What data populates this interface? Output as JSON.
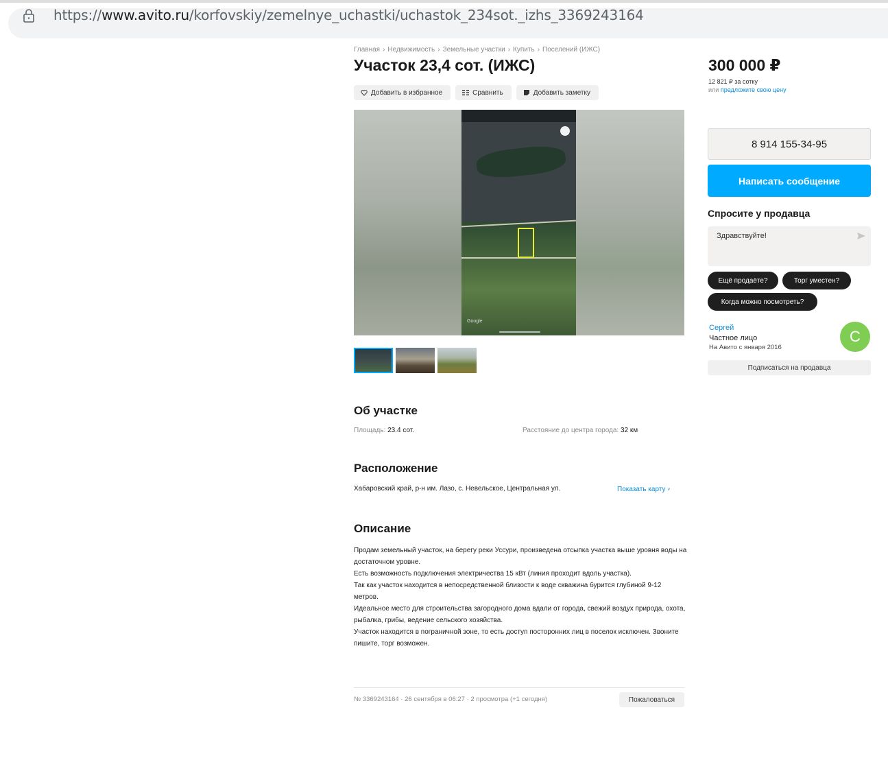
{
  "browser": {
    "url_prefix": "https://",
    "url_host": "www.avito.ru",
    "url_path": "/korfovskiy/zemelnye_uchastki/uchastok_234sot._izhs_3369243164"
  },
  "breadcrumbs": [
    "Главная",
    "Недвижимость",
    "Земельные участки",
    "Купить",
    "Поселений (ИЖС)"
  ],
  "breadcrumb_separator": "›",
  "listing": {
    "title": "Участок 23,4 сот. (ИЖС)",
    "actions": {
      "favorite": "Добавить в избранное",
      "compare": "Сравнить",
      "note": "Добавить заметку"
    },
    "photo_watermark": "Google"
  },
  "about": {
    "heading": "Об участке",
    "area_label": "Площадь:",
    "area_value": "23.4 сот.",
    "distance_label": "Расстояние до центра города:",
    "distance_value": "32 км"
  },
  "location": {
    "heading": "Расположение",
    "address": "Хабаровский край, р-н им. Лазо, с. Невельское, Центральная ул.",
    "map_link": "Показать карту"
  },
  "description": {
    "heading": "Описание",
    "text": "Продам земельный участок, на берегу реки Уссури, произведена отсыпка участка выше уровня воды на достаточном уровне.\nЕсть возможность подключения электричества 15 кВт (линия проходит вдоль участка).\nТак как участок находится в непосредственной близости к воде скважина бурится глубиной 9-12 метров.\nИдеальное место для строительства загородного дома вдали от города, свежий воздух природа, охота, рыбалка, грибы, ведение сельского хозяйства.\nУчасток находится в пограничной зоне, то есть доступ посторонних лиц в поселок исключен. Звоните пишите, торг возможен."
  },
  "footer": {
    "meta": "№ 3369243164 · 26 сентября в 06:27 · 2 просмотра (+1 сегодня)",
    "report": "Пожаловаться"
  },
  "sidebar": {
    "price": "300 000 ₽",
    "price_per": "12 821 ₽ за сотку",
    "offer_prefix": "или",
    "offer_link": "предложите свою цену",
    "phone": "8 914 155-34-95",
    "message_button": "Написать сообщение",
    "ask_heading": "Спросите у продавца",
    "ask_placeholder": "Здравствуйте!",
    "chips": [
      "Ещё продаёте?",
      "Торг уместен?",
      "Когда можно посмотреть?"
    ],
    "seller_name": "Сергей",
    "seller_type": "Частное лицо",
    "seller_since": "На Авито с января 2016",
    "avatar_letter": "С",
    "subscribe": "Подписаться на продавца"
  },
  "colors": {
    "accent": "#00aaff",
    "link": "#0a8dd6",
    "avatar": "#7fcd52"
  }
}
